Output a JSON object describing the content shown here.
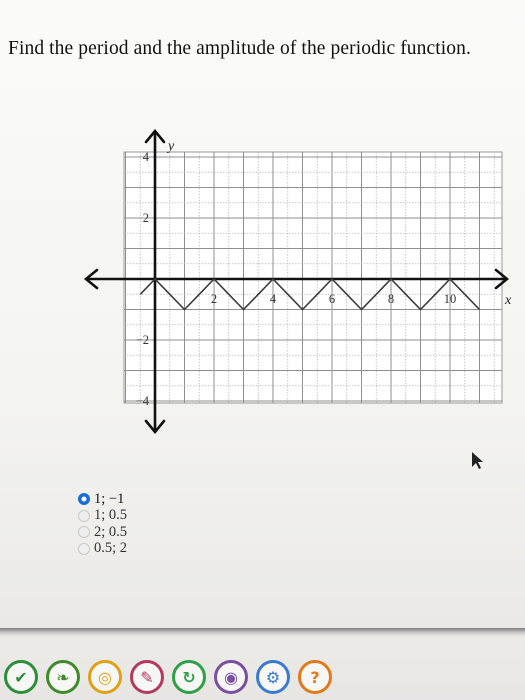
{
  "question": {
    "text": "Find the period and the amplitude of the periodic function."
  },
  "chart_data": {
    "type": "line",
    "xlabel": "x",
    "ylabel": "y",
    "xlim": [
      -1,
      11
    ],
    "ylim": [
      -4.5,
      4.5
    ],
    "x_ticks": [
      "2",
      "4",
      "6",
      "8",
      "10"
    ],
    "y_ticks": [
      "4",
      "2",
      "-2",
      "-4"
    ],
    "grid": true,
    "series": [
      {
        "x": [
          -0.5,
          0,
          0.5,
          1,
          1.5,
          2,
          2.5,
          3,
          3.5,
          4,
          4.5,
          5,
          5.5,
          6,
          6.5,
          7,
          7.5,
          8,
          8.5,
          9,
          9.5,
          10,
          10.5,
          11
        ],
        "y": [
          -0.5,
          0,
          -0.5,
          -1,
          -0.5,
          0,
          -0.5,
          -1,
          -0.5,
          0,
          -0.5,
          -1,
          -0.5,
          0,
          -0.5,
          -1,
          -0.5,
          0,
          -0.5,
          -1,
          -0.5,
          0,
          -0.5,
          -1
        ]
      }
    ]
  },
  "choices": [
    {
      "label": "1; −1",
      "selected": true
    },
    {
      "label": "1; 0.5",
      "selected": false
    },
    {
      "label": "2; 0.5",
      "selected": false
    },
    {
      "label": "0.5; 2",
      "selected": false
    }
  ],
  "taskbar": {
    "icons": [
      "check-icon",
      "leaf-icon",
      "target-icon",
      "pin-icon",
      "circle-arrow-icon",
      "eye-icon",
      "settings-icon",
      "help-icon"
    ]
  }
}
